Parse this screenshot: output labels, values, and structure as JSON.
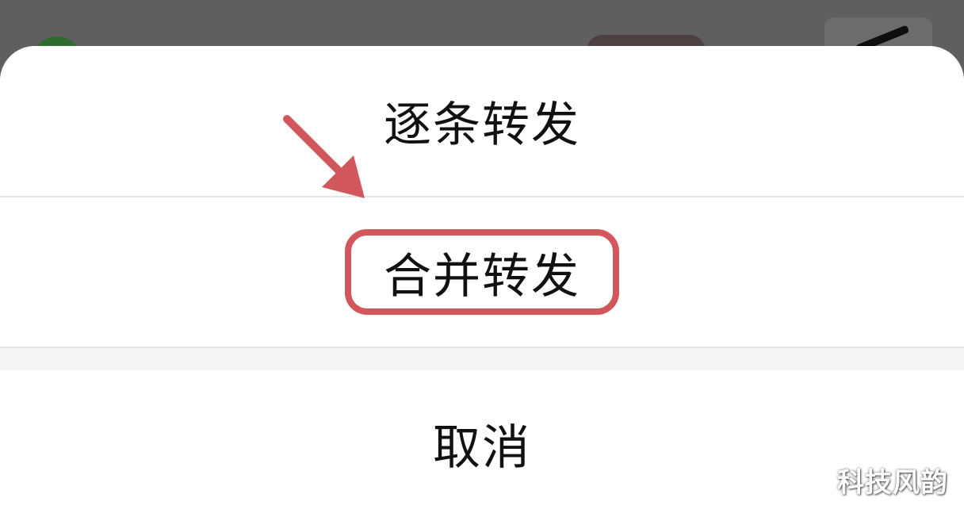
{
  "action_sheet": {
    "options": [
      {
        "label": "逐条转发"
      },
      {
        "label": "合并转发"
      }
    ],
    "cancel_label": "取消"
  },
  "annotation": {
    "highlight_color": "#d2575d",
    "highlighted_option": "合并转发"
  },
  "watermark": {
    "text": "科技风韵"
  },
  "colors": {
    "overlay": "#5f5f5f",
    "sheet_background": "#ffffff",
    "divider": "#e4e4e4",
    "gap": "#f4f4f4",
    "text": "#111111"
  }
}
